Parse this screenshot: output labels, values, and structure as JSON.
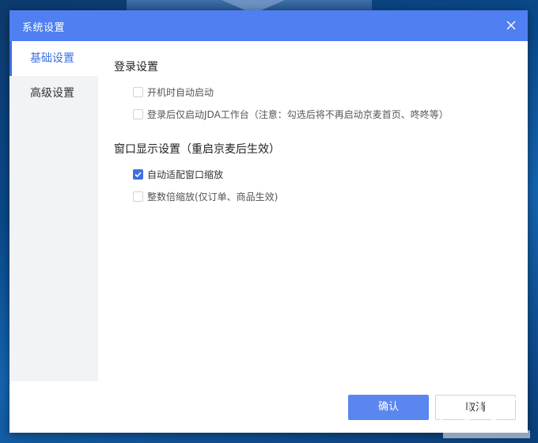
{
  "dialog": {
    "title": "系统设置",
    "close_icon": "close-icon"
  },
  "sidebar": {
    "items": [
      {
        "label": "基础设置",
        "active": true
      },
      {
        "label": "高级设置",
        "active": false
      }
    ]
  },
  "login_section": {
    "title": "登录设置",
    "options": [
      {
        "label": "开机时自动启动",
        "checked": false
      },
      {
        "label": "登录后仅启动JDA工作台（注意：勾选后将不再启动京麦首页、咚咚等）",
        "checked": false
      }
    ]
  },
  "window_section": {
    "title": "窗口显示设置（重启京麦后生效）",
    "options": [
      {
        "label": "自动适配窗口缩放",
        "checked": true
      },
      {
        "label": "整数倍缩放(仅订单、商品生效)",
        "checked": false
      }
    ]
  },
  "footer": {
    "ok_label": "确认",
    "cancel_label": "取消"
  },
  "colors": {
    "accent": "#4f7ff0",
    "checkbox_checked": "#3d6fe0"
  }
}
